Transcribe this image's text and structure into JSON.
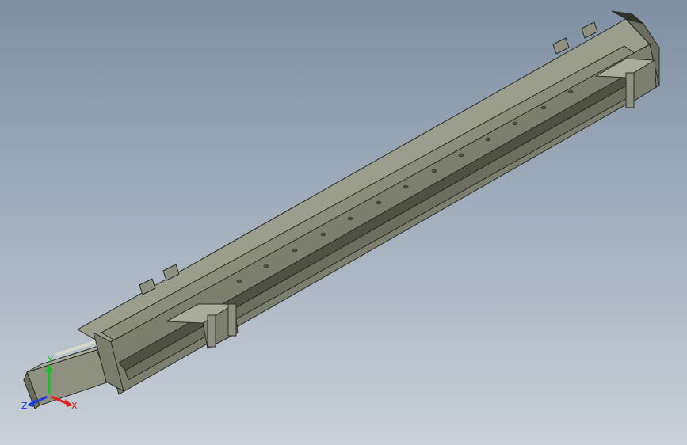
{
  "viewport": {
    "background_top": "#7e8fa3",
    "background_bottom": "#c9d0d8"
  },
  "model": {
    "body_color": "#8e9080",
    "body_dark": "#5e6052",
    "body_light": "#a9ab9b",
    "edge_color": "#2b2b27"
  },
  "triad": {
    "x_label": "X",
    "y_label": "Y",
    "z_label": "Z",
    "x_color": "#e0201a",
    "y_color": "#1ebd2a",
    "z_color": "#1d3bd8"
  }
}
